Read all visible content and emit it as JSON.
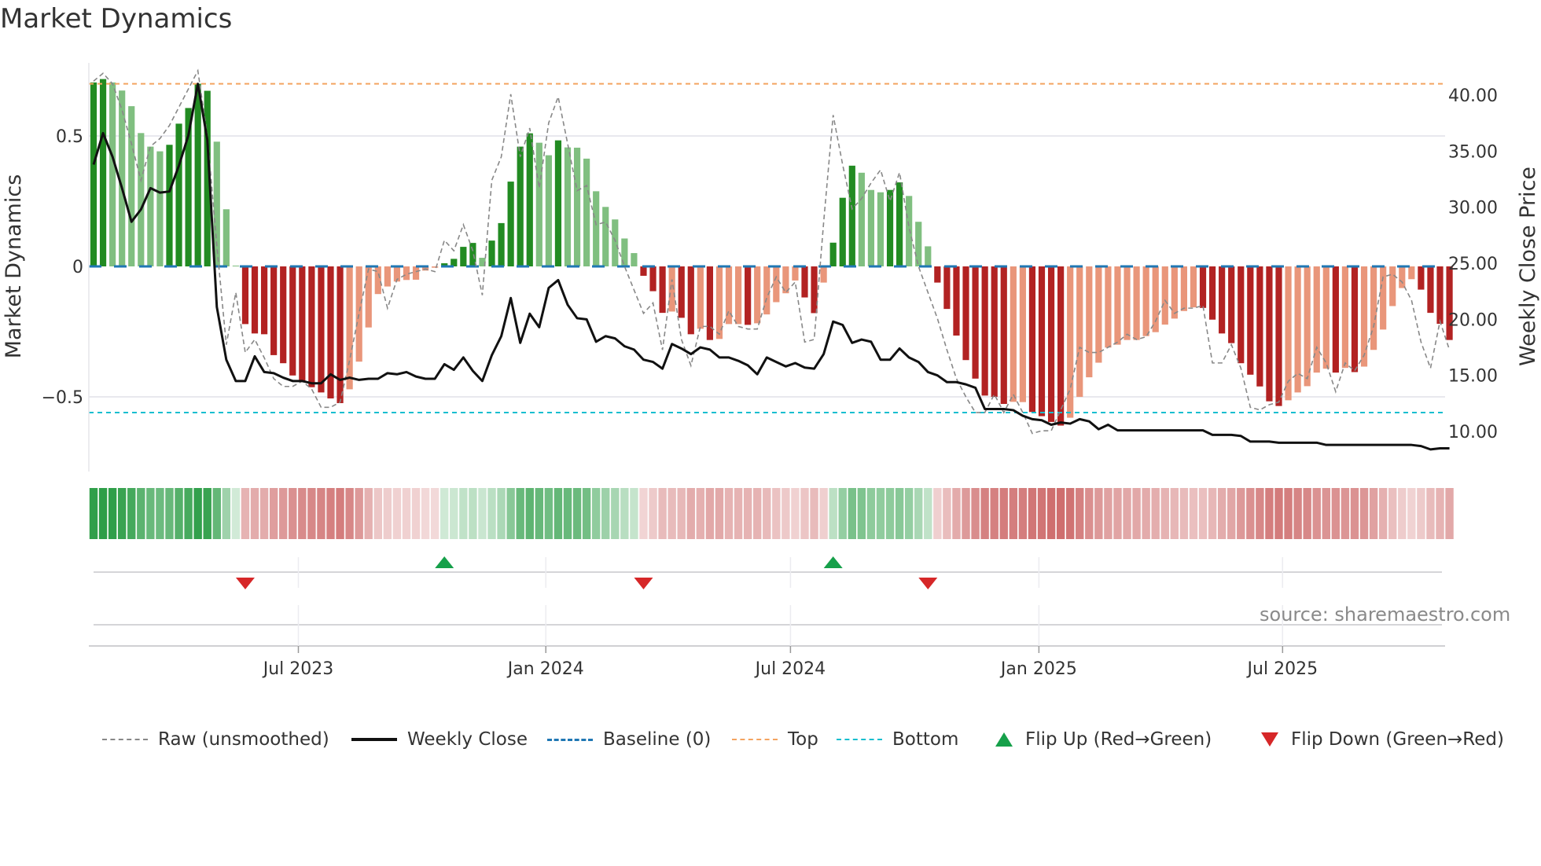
{
  "title": "Market Dynamics",
  "source_note": "source: sharemaestro.com",
  "colors": {
    "bar_green_strong": "#228b22",
    "bar_green_weak": "#80bf80",
    "bar_red_strong": "#b22222",
    "bar_red_weak": "#e9967a",
    "strip_green": "#2e9e48",
    "strip_red": "#c85a5a",
    "raw": "#888888",
    "close": "#111111",
    "baseline": "#1f77b4",
    "top": "#f4a460",
    "bottom": "#17becf",
    "flip_up": "#16a04a",
    "flip_down": "#d62728",
    "grid": "#e8e8ee"
  },
  "legend": {
    "raw": "Raw (unsmoothed)",
    "close": "Weekly Close",
    "baseline": "Baseline (0)",
    "top": "Top",
    "bottom": "Bottom",
    "flip_up": "Flip Up (Red→Green)",
    "flip_down": "Flip Down (Green→Red)"
  },
  "chart_data": {
    "type": "bar",
    "title": "Market Dynamics",
    "ylabel": "Market Dynamics",
    "y2label": "Weekly Close Price",
    "ylim": [
      -0.786,
      0.78
    ],
    "y2lim": [
      6.43,
      42.87
    ],
    "yticks": [
      {
        "value": 0.5,
        "label": "0.5"
      },
      {
        "value": 0,
        "label": "0"
      },
      {
        "value": -0.5,
        "label": "−0.5"
      }
    ],
    "y2ticks": [
      {
        "value": 40,
        "label": "40.00"
      },
      {
        "value": 35,
        "label": "35.00"
      },
      {
        "value": 30,
        "label": "30.00"
      },
      {
        "value": 25,
        "label": "25.00"
      },
      {
        "value": 20,
        "label": "20.00"
      },
      {
        "value": 15,
        "label": "15.00"
      },
      {
        "value": 10,
        "label": "10.00"
      }
    ],
    "xticks": [
      {
        "week": 21.6,
        "label": "Jul 2023"
      },
      {
        "week": 47.7,
        "label": "Jan 2024"
      },
      {
        "week": 73.5,
        "label": "Jul 2024"
      },
      {
        "week": 99.7,
        "label": "Jan 2025"
      },
      {
        "week": 125.4,
        "label": "Jul 2025"
      }
    ],
    "top_level": 0.7,
    "bottom_level": -0.56,
    "baseline": 0,
    "bar_emphasis": "DDLLLLLLDDDDDLLLDDDDDDDDDDDLLLLLLLLLLDDDDLDDDDDLLDLLLLLLLLDDDLDDLDLLLDLLLLLDDLDDDLLLDDLLLDDDDDDDDLLDDDDLLLLLLLLLLLLLLDDDDDDDDDLLLLLDLDLLLLLLDDDD",
    "bars": [
      0.705,
      0.718,
      0.705,
      0.674,
      0.614,
      0.511,
      0.459,
      0.441,
      0.466,
      0.547,
      0.607,
      0.7,
      0.673,
      0.478,
      0.219,
      0.003,
      -0.221,
      -0.257,
      -0.26,
      -0.34,
      -0.371,
      -0.418,
      -0.439,
      -0.463,
      -0.483,
      -0.506,
      -0.524,
      -0.471,
      -0.365,
      -0.234,
      -0.106,
      -0.077,
      -0.058,
      -0.052,
      -0.051,
      -0.016,
      -0.005,
      0.012,
      0.029,
      0.075,
      0.09,
      0.033,
      0.099,
      0.166,
      0.325,
      0.459,
      0.51,
      0.474,
      0.426,
      0.483,
      0.456,
      0.455,
      0.413,
      0.288,
      0.228,
      0.18,
      0.107,
      0.051,
      -0.036,
      -0.095,
      -0.178,
      -0.173,
      -0.197,
      -0.26,
      -0.239,
      -0.282,
      -0.278,
      -0.221,
      -0.221,
      -0.224,
      -0.218,
      -0.184,
      -0.137,
      -0.103,
      -0.054,
      -0.119,
      -0.179,
      -0.062,
      0.091,
      0.263,
      0.386,
      0.359,
      0.293,
      0.284,
      0.293,
      0.322,
      0.27,
      0.171,
      0.077,
      -0.062,
      -0.163,
      -0.265,
      -0.359,
      -0.43,
      -0.495,
      -0.5,
      -0.527,
      -0.519,
      -0.52,
      -0.558,
      -0.574,
      -0.596,
      -0.61,
      -0.58,
      -0.5,
      -0.425,
      -0.369,
      -0.311,
      -0.3,
      -0.282,
      -0.282,
      -0.267,
      -0.252,
      -0.223,
      -0.2,
      -0.171,
      -0.157,
      -0.159,
      -0.204,
      -0.257,
      -0.294,
      -0.371,
      -0.415,
      -0.46,
      -0.517,
      -0.535,
      -0.513,
      -0.483,
      -0.459,
      -0.407,
      -0.392,
      -0.407,
      -0.389,
      -0.405,
      -0.384,
      -0.32,
      -0.242,
      -0.152,
      -0.083,
      -0.049,
      -0.089,
      -0.178,
      -0.22,
      -0.282
    ],
    "raw": [
      0.71,
      0.74,
      0.7,
      0.6,
      0.47,
      0.33,
      0.46,
      0.49,
      0.54,
      0.61,
      0.68,
      0.75,
      0.5,
      0.08,
      -0.3,
      -0.1,
      -0.33,
      -0.28,
      -0.35,
      -0.43,
      -0.46,
      -0.46,
      -0.44,
      -0.47,
      -0.54,
      -0.54,
      -0.52,
      -0.36,
      -0.18,
      -0.01,
      -0.02,
      -0.16,
      -0.05,
      -0.03,
      -0.02,
      -0.01,
      -0.02,
      0.1,
      0.06,
      0.16,
      0.06,
      -0.11,
      0.33,
      0.42,
      0.66,
      0.42,
      0.53,
      0.3,
      0.55,
      0.65,
      0.47,
      0.29,
      0.31,
      0.16,
      0.17,
      0.1,
      0.0,
      -0.09,
      -0.18,
      -0.14,
      -0.32,
      -0.05,
      -0.28,
      -0.38,
      -0.23,
      -0.23,
      -0.26,
      -0.17,
      -0.23,
      -0.24,
      -0.24,
      -0.12,
      -0.04,
      -0.1,
      -0.06,
      -0.29,
      -0.28,
      0.17,
      0.58,
      0.39,
      0.22,
      0.26,
      0.32,
      0.37,
      0.25,
      0.36,
      0.15,
      0.0,
      -0.1,
      -0.2,
      -0.32,
      -0.43,
      -0.5,
      -0.56,
      -0.56,
      -0.49,
      -0.56,
      -0.49,
      -0.56,
      -0.64,
      -0.63,
      -0.63,
      -0.55,
      -0.47,
      -0.31,
      -0.33,
      -0.33,
      -0.31,
      -0.29,
      -0.26,
      -0.28,
      -0.27,
      -0.21,
      -0.13,
      -0.18,
      -0.16,
      -0.16,
      -0.15,
      -0.37,
      -0.37,
      -0.3,
      -0.39,
      -0.54,
      -0.55,
      -0.53,
      -0.52,
      -0.44,
      -0.41,
      -0.43,
      -0.31,
      -0.37,
      -0.48,
      -0.37,
      -0.4,
      -0.34,
      -0.23,
      -0.04,
      -0.03,
      -0.06,
      -0.13,
      -0.29,
      -0.39,
      -0.21,
      -0.32
    ],
    "weekly_close": [
      33.8,
      36.6,
      34.5,
      31.7,
      28.7,
      29.8,
      31.7,
      31.3,
      31.4,
      33.7,
      36.4,
      41.0,
      36.0,
      21.1,
      16.4,
      14.5,
      14.5,
      16.7,
      15.3,
      15.2,
      14.8,
      14.5,
      14.5,
      14.3,
      14.3,
      15.1,
      14.6,
      14.8,
      14.6,
      14.7,
      14.7,
      15.2,
      15.1,
      15.3,
      14.9,
      14.7,
      14.7,
      16.0,
      15.5,
      16.6,
      15.4,
      14.5,
      16.8,
      18.5,
      21.9,
      17.9,
      20.5,
      19.3,
      22.8,
      23.5,
      21.3,
      20.1,
      20.0,
      18.0,
      18.5,
      18.3,
      17.6,
      17.3,
      16.4,
      16.2,
      15.6,
      17.8,
      17.4,
      16.9,
      17.5,
      17.3,
      16.6,
      16.6,
      16.3,
      15.9,
      15.1,
      16.6,
      16.2,
      15.8,
      16.1,
      15.7,
      15.6,
      16.9,
      19.8,
      19.5,
      17.9,
      18.2,
      18.0,
      16.4,
      16.4,
      17.4,
      16.6,
      16.2,
      15.3,
      15.0,
      14.4,
      14.4,
      14.2,
      13.9,
      12.0,
      12.0,
      12.0,
      11.9,
      11.4,
      11.1,
      11.0,
      10.6,
      10.8,
      10.7,
      11.1,
      10.9,
      10.2,
      10.6,
      10.1,
      10.1,
      10.1,
      10.1,
      10.1,
      10.1,
      10.1,
      10.1,
      10.1,
      10.1,
      9.7,
      9.7,
      9.7,
      9.6,
      9.1,
      9.1,
      9.1,
      9.0,
      9.0,
      9.0,
      9.0,
      9.0,
      8.8,
      8.8,
      8.8,
      8.8,
      8.8,
      8.8,
      8.8,
      8.8,
      8.8,
      8.8,
      8.7,
      8.4,
      8.5,
      8.5
    ],
    "flip_up_weeks": [
      37,
      78
    ],
    "flip_down_weeks": [
      16,
      58,
      88
    ]
  }
}
